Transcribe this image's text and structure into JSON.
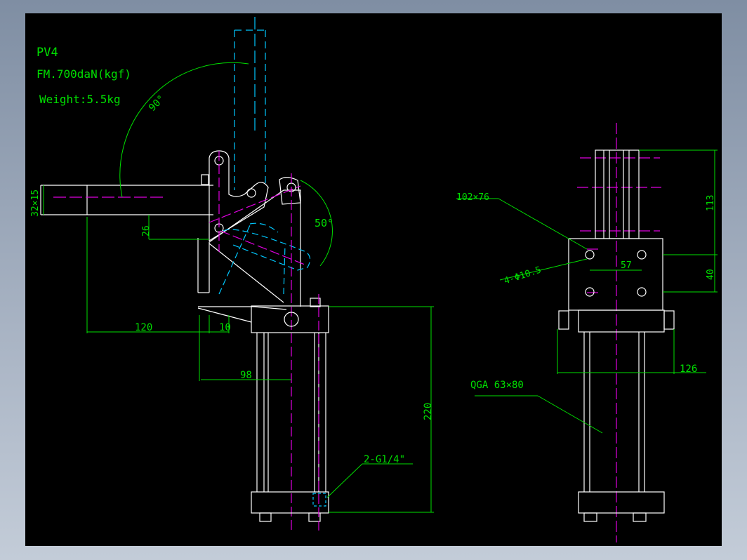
{
  "title_block": {
    "model": "PV4",
    "force": "FM.700daN(kgf)",
    "weight": "Weight:5.5kg"
  },
  "dimensions": {
    "handle_angle": "90°",
    "arm_angle": "50°",
    "handle_section": "32×15",
    "offset_height": "26",
    "reach": "120",
    "gap": "10",
    "base_offset": "98",
    "stroke_height": "220",
    "port_label": "2-G1/4\"",
    "plate_size": "102×76",
    "holes": "4-Φ10.5",
    "hole_pitch": "57",
    "top_height": "113",
    "plate_height": "40",
    "base_width": "126",
    "cylinder": "QGA 63×80"
  },
  "colors": {
    "background": "#000000",
    "outline": "#ffffff",
    "dimension": "#00e000",
    "centerline": "#e000e0",
    "hidden": "#00c8ff"
  }
}
